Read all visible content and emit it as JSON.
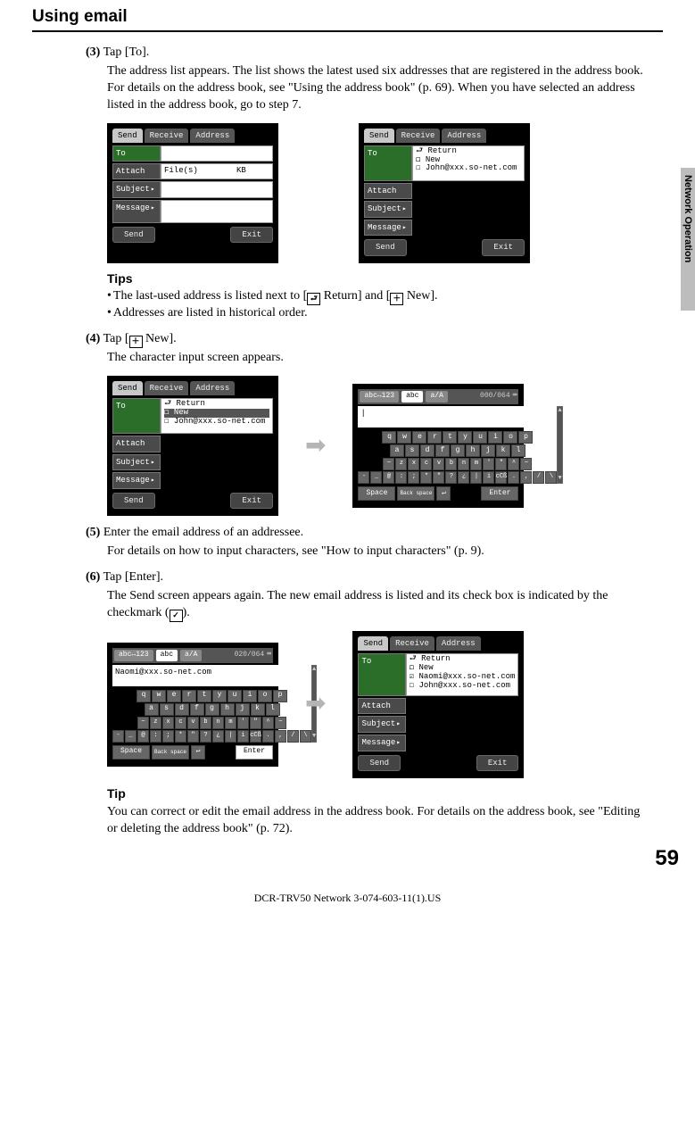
{
  "title": "Using email",
  "side_tab": "Network Operation",
  "page_number": "59",
  "footer": "DCR-TRV50 Network 3-074-603-11(1).US",
  "steps": {
    "s3": {
      "num": "(3)",
      "lead": "Tap [To].",
      "body": "The address list appears. The list shows the latest used six addresses that are registered in the address book. For details on the address book, see \"Using the address book\" (p. 69). When you have selected an address listed in the address book, go to step 7."
    },
    "s4": {
      "num": "(4)",
      "lead_pre": "Tap [",
      "lead_post": " New].",
      "body": "The character input screen appears."
    },
    "s5": {
      "num": "(5)",
      "lead": "Enter the email address of an addressee.",
      "body": "For details on how to input characters, see \"How to input characters\" (p. 9)."
    },
    "s6": {
      "num": "(6)",
      "lead": "Tap [Enter].",
      "body": "The Send screen appears again. The new email address is listed and its check box is indicated by the checkmark (",
      "body_post": ")."
    }
  },
  "tips": {
    "head1": "Tips",
    "t1_pre": "The last-used address is listed next to [",
    "t1_mid": " Return] and [",
    "t1_post": " New].",
    "t2": "Addresses are listed in historical order.",
    "head2": "Tip",
    "t3": "You can correct or edit the email address in the address book. For details on the address book, see \"Editing or deleting the address book\" (p. 72)."
  },
  "screens": {
    "tabs": {
      "send": "Send",
      "receive": "Receive",
      "address": "Address"
    },
    "labels": {
      "to": "To",
      "attach": "Attach",
      "subject": "Subject",
      "message": "Message"
    },
    "buttons": {
      "send": "Send",
      "exit": "Exit",
      "space": "Space",
      "back": "Back space",
      "enter": "Enter"
    },
    "filefield": "File(s)",
    "kb": "KB",
    "list": {
      "return": "⮐ Return",
      "new": "◻ New",
      "john": "☐ John@xxx.so-net.com",
      "naomi_chk": "☑ Naomi@xxx.so-net.com",
      "john_un": "☐ John@xxx.so-net.com"
    },
    "ci": {
      "mode1": "abc↔123",
      "mode2": "abc",
      "mode3": "a/A",
      "counter1": "000/064",
      "counter2": "020/064",
      "field2": "Naomi@xxx.so-net.com",
      "r1": [
        "q",
        "w",
        "e",
        "r",
        "t",
        "y",
        "u",
        "i",
        "o",
        "p"
      ],
      "r2": [
        "a",
        "s",
        "d",
        "f",
        "g",
        "h",
        "j",
        "k",
        "l"
      ],
      "r3": [
        "~",
        "z",
        "x",
        "c",
        "v",
        "b",
        "n",
        "m",
        "'",
        "\"",
        "^",
        "~"
      ],
      "r4": [
        "-",
        "_",
        "@",
        ":",
        ";",
        "*",
        "\"",
        "?",
        "¿",
        "|",
        "i",
        "cCß",
        ".",
        ",",
        "/",
        "\\"
      ]
    }
  }
}
